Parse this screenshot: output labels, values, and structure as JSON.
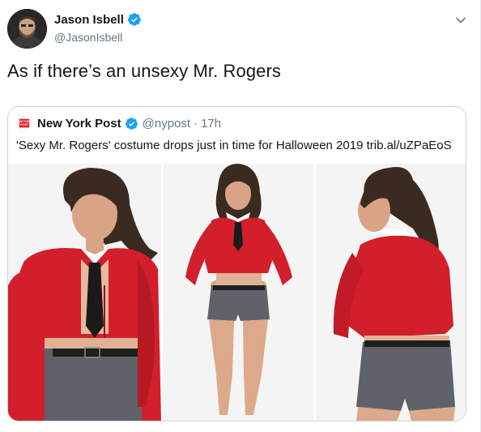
{
  "tweet": {
    "author": {
      "display_name": "Jason Isbell",
      "handle": "@JasonIsbell",
      "verified": true,
      "avatar_icon": "avatar-photo"
    },
    "text": "As if there’s an unsexy Mr. Rogers",
    "menu_icon": "chevron-down-icon"
  },
  "quoted": {
    "display_name": "New York Post",
    "handle": "@nypost",
    "separator": "·",
    "time": "17h",
    "verified": true,
    "logo_icon": "nypost-logo",
    "logo_text": "NEW YORK POST",
    "text": "'Sexy Mr. Rogers' costume drops just in time for Halloween 2019 trib.al/uZPaEoS",
    "photos": [
      {
        "icon": "costume-front-closeup-photo"
      },
      {
        "icon": "costume-full-body-photo"
      },
      {
        "icon": "costume-back-view-photo"
      }
    ]
  },
  "colors": {
    "verified_blue": "#1da1f2",
    "secondary_text": "#657786",
    "border": "#ccd6dd",
    "cardigan_red": "#d21f2b",
    "shorts_gray": "#5f6268"
  }
}
